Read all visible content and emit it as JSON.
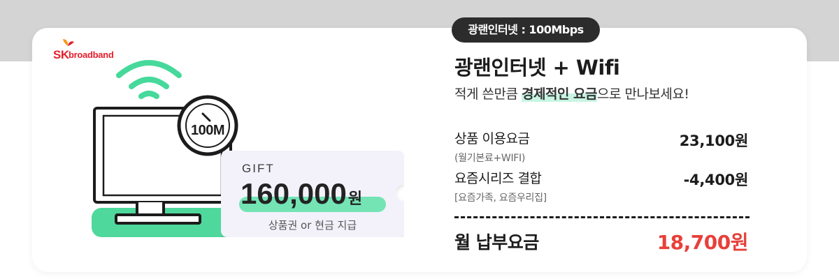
{
  "brand": {
    "logo_sk": "SK",
    "logo_text": "broadband",
    "color": "#e3202e"
  },
  "illustration": {
    "speed_label": "100M",
    "accent_color": "#46d99b"
  },
  "gift": {
    "label": "GIFT",
    "amount": "160,000",
    "currency": "원",
    "note": "상품권 or 현금 지급"
  },
  "badge": "광랜인터넷 : 100Mbps",
  "title": "광랜인터넷 + Wifi",
  "subtitle": {
    "before": "적게 쓴만큼 ",
    "highlight": "경제적인 요금",
    "after": "으로 만나보세요!"
  },
  "rows": [
    {
      "label": "상품 이용요금",
      "sub": "(월기본료+WIFI)",
      "value": "23,100원"
    },
    {
      "label": "요즘시리즈 결합",
      "sub": "[요즘가족, 요즘우리집]",
      "value": "-4,400원"
    }
  ],
  "total": {
    "label": "월 납부요금",
    "value": "18,700원",
    "color": "#e8403a"
  }
}
